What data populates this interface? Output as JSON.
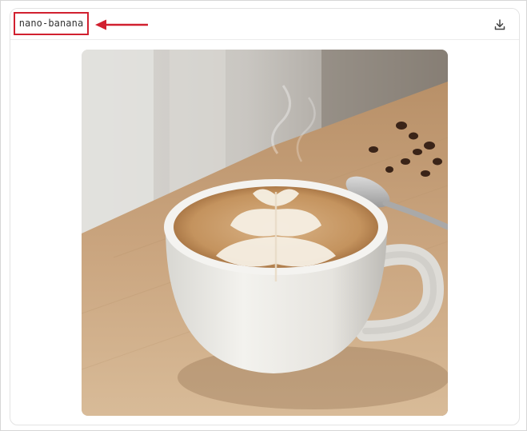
{
  "card": {
    "model_label": "nano-banana"
  },
  "icons": {
    "download": "download-icon",
    "annotation_arrow": "arrow-left-icon"
  },
  "colors": {
    "highlight": "#d1202f",
    "wood": "#caa47c",
    "cup": "#efefec",
    "latte": "#c99a67"
  },
  "image": {
    "subject": "latte-art-coffee-cup"
  }
}
